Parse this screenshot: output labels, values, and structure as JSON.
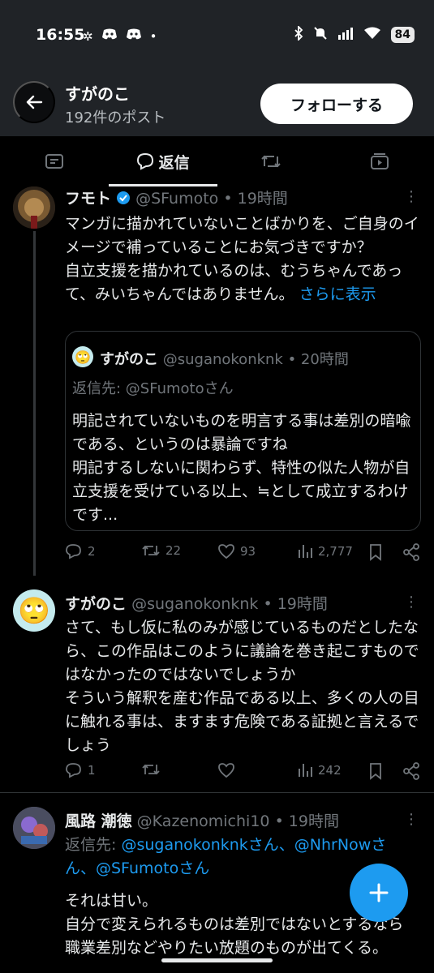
{
  "status": {
    "time": "16:55",
    "battery": "84"
  },
  "header": {
    "name": "すがのこ",
    "posts_count": "192件のポスト",
    "follow_label": "フォローする"
  },
  "tabs": {
    "active_label": "返信"
  },
  "post1": {
    "name": "フモト",
    "handle": "@SFumoto",
    "time": "• 19時間",
    "text": "マンガに描かれていないことばかりを、ご自身のイメージで補っていることにお気づきですか？\n自立支援を描かれているのは、むうちゃんであって、みいちゃんではありません。",
    "show_more": "さらに表示",
    "quote": {
      "name": "すがのこ",
      "handle": "@suganokonknk",
      "time": "• 20時間",
      "reply_to": "返信先: @SFumotoさん",
      "text": "明記されていないものを明言する事は差別の暗喩である、というのは暴論ですね\n明記するしないに関わらず、特性の似た人物が自立支援を受けている以上、≒として成立するわけです..."
    },
    "replies": "2",
    "reposts": "22",
    "likes": "93",
    "views": "2,777"
  },
  "post2": {
    "name": "すがのこ",
    "handle": "@suganokonknk",
    "time": "• 19時間",
    "text": "さて、もし仮に私のみが感じているものだとしたなら、この作品はこのように議論を巻き起こすものではなかったのではないでしょうか\nそういう解釈を産む作品である以上、多くの人の目に触れる事は、ますます危険である証拠と言えるでしょう",
    "replies": "1",
    "views": "242"
  },
  "post3": {
    "name": "風路 潮徳",
    "handle": "@Kazenomichi10",
    "time": "• 19時間",
    "reply_to_prefix": "返信先: ",
    "reply_to_links": "@suganokonknkさん、@NhrNowさん、@SFumotoさん",
    "text": "それは甘い。\n自分で変えられるものは差別ではないとするなら職業差別などやりたい放題のものが出てくる。"
  },
  "colors": {
    "accent": "#1d9bf0",
    "verified": "#1d9bf0"
  }
}
